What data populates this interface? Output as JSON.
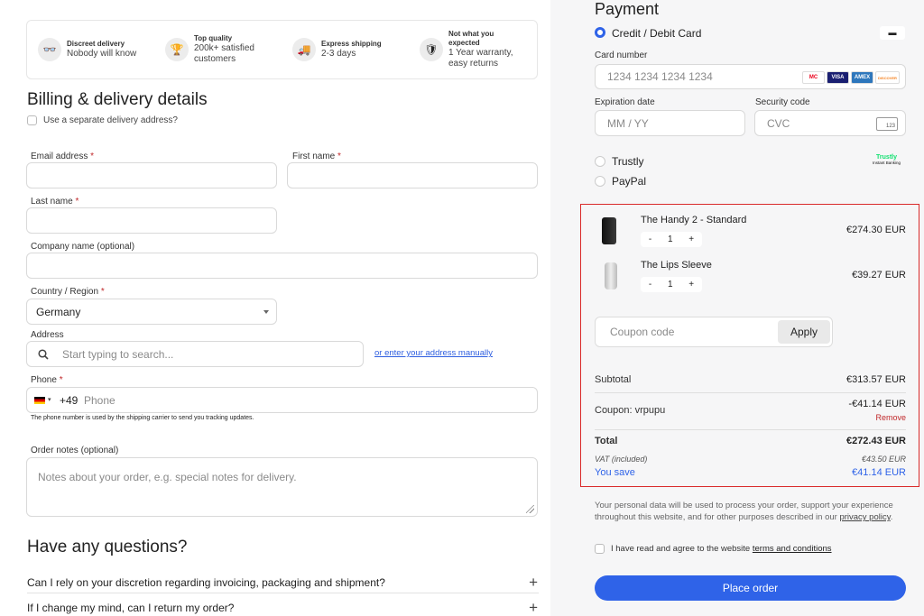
{
  "features": [
    {
      "title": "Discreet delivery",
      "sub": "Nobody will know",
      "icon": "incognito-icon",
      "glyph": "👓"
    },
    {
      "title": "Top quality",
      "sub": "200k+ satisfied customers",
      "icon": "trophy-icon",
      "glyph": "🏆"
    },
    {
      "title": "Express shipping",
      "sub": "2-3 days",
      "icon": "fast-truck-icon",
      "glyph": "🚚"
    },
    {
      "title": "Not what you expected",
      "sub": "1 Year warranty, easy returns",
      "icon": "shield-check-icon",
      "glyph": "🛡"
    }
  ],
  "billing": {
    "title": "Billing & delivery details",
    "separate_delivery": "Use a separate delivery address?",
    "email_label": "Email address",
    "first_name_label": "First name",
    "last_name_label": "Last name",
    "company_label": "Company name (optional)",
    "country_label": "Country / Region",
    "country_value": "Germany",
    "address_label": "Address",
    "address_placeholder": "Start typing to search...",
    "address_manual": "or enter your address manually",
    "phone_label": "Phone",
    "phone_code": "+49",
    "phone_placeholder": "Phone",
    "phone_note": "The phone number is used by the shipping carrier to send you tracking updates.",
    "notes_label": "Order notes (optional)",
    "notes_placeholder": "Notes about your order, e.g. special notes for delivery.",
    "required_mark": "*"
  },
  "questions": {
    "title": "Have any questions?",
    "items": [
      "Can I rely on your discretion regarding invoicing, packaging and shipment?",
      "If I change my mind, can I return my order?"
    ],
    "plus": "+"
  },
  "payment": {
    "title": "Payment",
    "method_card": "Credit / Debit Card",
    "card_number_label": "Card number",
    "card_number_placeholder": "1234 1234 1234 1234",
    "expiry_label": "Expiration date",
    "expiry_placeholder": "MM / YY",
    "cvc_label": "Security code",
    "cvc_placeholder": "CVC",
    "cvc_icon_text": "123",
    "method_trustly": "Trustly",
    "trustly_logo": "Trustly",
    "trustly_logo_sub": "Instant Banking",
    "method_paypal": "PayPal",
    "brands": [
      "MC",
      "VISA",
      "AMEX",
      "DISCOVER"
    ]
  },
  "cart": {
    "items": [
      {
        "name": "The Handy 2 - Standard",
        "qty": "1",
        "price": "€274.30 EUR"
      },
      {
        "name": "The Lips Sleeve",
        "qty": "1",
        "price": "€39.27 EUR"
      }
    ],
    "minus": "-",
    "plus": "+",
    "coupon_placeholder": "Coupon code",
    "apply": "Apply",
    "subtotal_label": "Subtotal",
    "subtotal_value": "€313.57 EUR",
    "coupon_label": "Coupon: vrpupu",
    "coupon_value": "-€41.14 EUR",
    "remove": "Remove",
    "total_label": "Total",
    "total_value": "€272.43 EUR",
    "vat_label": "VAT (included)",
    "vat_value": "€43.50 EUR",
    "save_label": "You save",
    "save_value": "€41.14 EUR"
  },
  "footer": {
    "privacy_text": "Your personal data will be used to process your order, support your experience throughout this website, and for other purposes described in our",
    "privacy_link": "privacy policy",
    "privacy_end": ".",
    "agree_text": "I have read and agree to the website",
    "terms_link": "terms and conditions",
    "place_order": "Place order"
  }
}
